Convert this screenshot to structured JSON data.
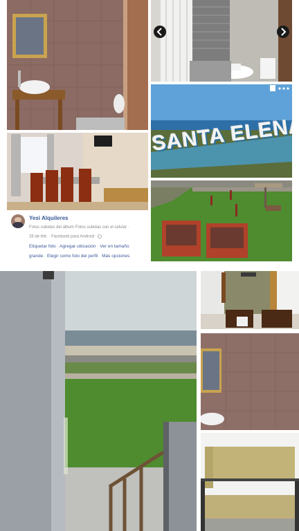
{
  "sign": {
    "text": "SANTA ELENA"
  },
  "post": {
    "author": "Yesi Alquileres",
    "line1": "Fotos subidas del álbum Fotos subidas con el celular ·",
    "line2": "26 de feb. · Facebook para Android · ",
    "actions_row1": [
      "Etiquetar foto",
      "Agregar ubicación",
      "Ver en tamaño"
    ],
    "actions_row2": [
      "grande",
      "Elegir como foto del perfil",
      "Más opciones"
    ],
    "separator": " · "
  },
  "icons": {
    "prev": "chevron-left-icon",
    "next": "chevron-right-icon",
    "more": "more-dots-icon",
    "bookmark": "bookmark-icon",
    "globe": "globe-icon"
  },
  "colors": {
    "tile_wall": "#8a6a62",
    "sky": "#5aa0d8",
    "grass": "#4e8a2e",
    "link": "#3b5998"
  }
}
